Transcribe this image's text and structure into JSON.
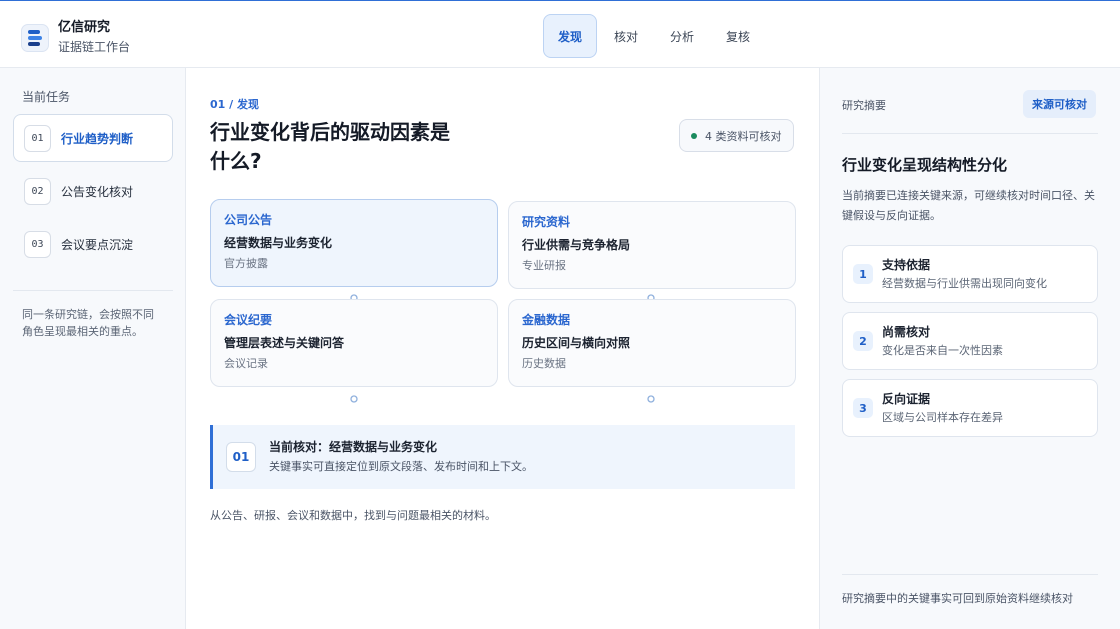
{
  "brand": {
    "name": "亿信研究",
    "subtitle": "证据链工作台",
    "logo_icon": "stacked-bars-logo-icon"
  },
  "nav": {
    "tabs": [
      {
        "label": "发现",
        "active": true
      },
      {
        "label": "核对"
      },
      {
        "label": "分析"
      },
      {
        "label": "复核"
      }
    ]
  },
  "sidebar": {
    "title": "当前任务",
    "tasks": [
      {
        "num": "01",
        "label": "行业趋势判断",
        "active": true
      },
      {
        "num": "02",
        "label": "公告变化核对"
      },
      {
        "num": "03",
        "label": "会议要点沉淀"
      }
    ],
    "note": "同一条研究链，会按照不同角色呈现最相关的重点。"
  },
  "main": {
    "eyebrow": "01 / 发现",
    "headline": "行业变化背后的驱动因素是什么?",
    "badge": "4 类资料可核对",
    "cards": [
      {
        "type": "公司公告",
        "title": "经营数据与业务变化",
        "sub": "官方披露",
        "active": true
      },
      {
        "type": "研究资料",
        "title": "行业供需与竞争格局",
        "sub": "专业研报"
      },
      {
        "type": "会议纪要",
        "title": "管理层表述与关键问答",
        "sub": "会议记录"
      },
      {
        "type": "金融数据",
        "title": "历史区间与横向对照",
        "sub": "历史数据"
      }
    ],
    "callout": {
      "num": "01",
      "title": "当前核对：经营数据与业务变化",
      "sub": "关键事实可直接定位到原文段落、发布时间和上下文。"
    },
    "footer": "从公告、研报、会议和数据中，找到与问题最相关的材料。"
  },
  "panel": {
    "label": "研究摘要",
    "badge": "来源可核对",
    "title": "行业变化呈现结构性分化",
    "desc": "当前摘要已连接关键来源，可继续核对时间口径、关键假设与反向证据。",
    "points": [
      {
        "num": "1",
        "title": "支持依据",
        "sub": "经营数据与行业供需出现同向变化"
      },
      {
        "num": "2",
        "title": "尚需核对",
        "sub": "变化是否来自一次性因素"
      },
      {
        "num": "3",
        "title": "反向证据",
        "sub": "区域与公司样本存在差异"
      }
    ],
    "footer": "研究摘要中的关键事实可回到原始资料继续核对"
  },
  "colors": {
    "accent": "#2f6fd6",
    "accent_text": "#1f5fc7",
    "ok_dot": "#1b8b5e"
  }
}
